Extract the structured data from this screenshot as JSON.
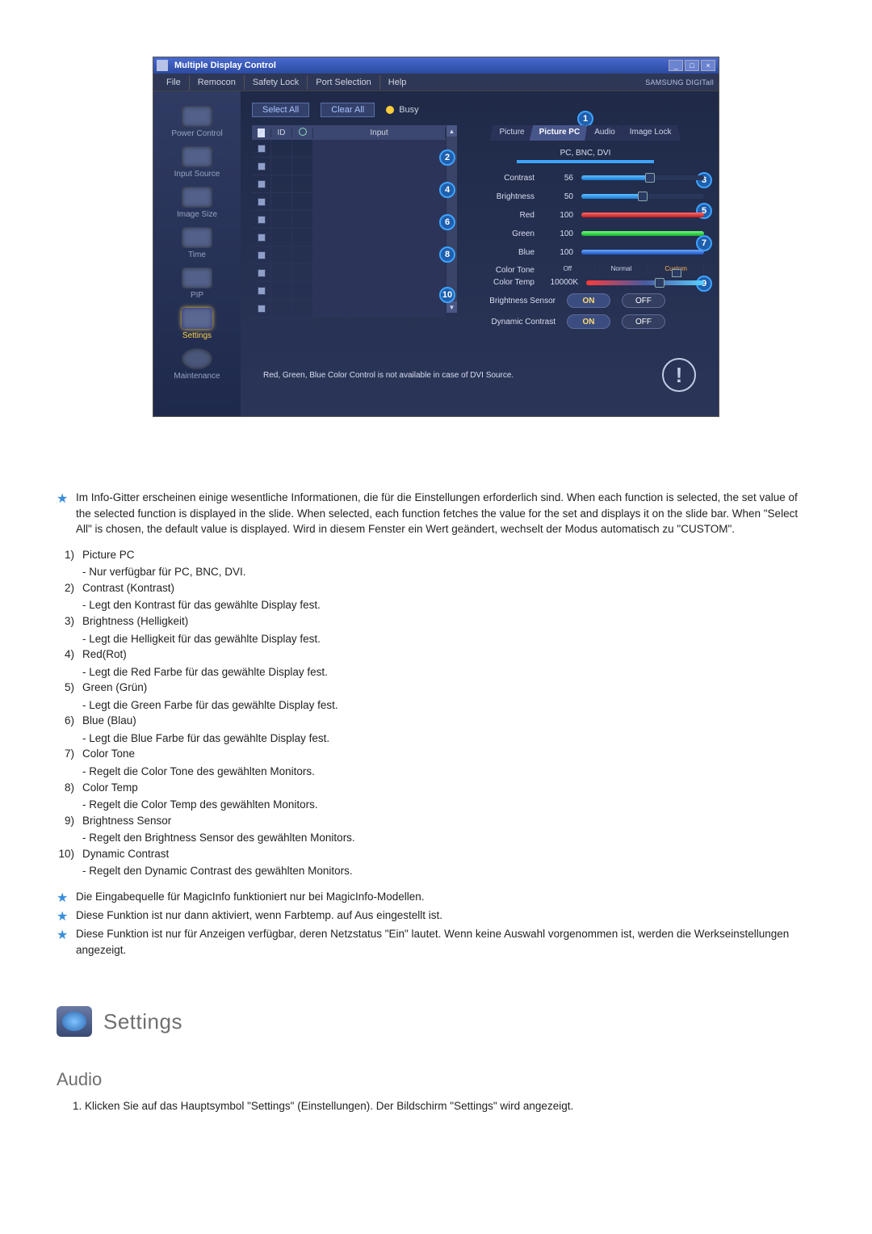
{
  "app": {
    "title": "Multiple Display Control",
    "brand": "SAMSUNG DIGITall",
    "menu": [
      "File",
      "Remocon",
      "Safety Lock",
      "Port Selection",
      "Help"
    ],
    "win_buttons": {
      "min": "_",
      "max": "□",
      "close": "×"
    },
    "sidebar": {
      "items": [
        {
          "label": "Power Control"
        },
        {
          "label": "Input Source"
        },
        {
          "label": "Image Size"
        },
        {
          "label": "Time"
        },
        {
          "label": "PIP"
        },
        {
          "label": "Settings"
        },
        {
          "label": "Maintenance"
        }
      ]
    },
    "top_actions": {
      "select_all": "Select All",
      "clear_all": "Clear All",
      "busy": "Busy"
    },
    "grid": {
      "cols": {
        "chk": "",
        "id": "ID",
        "pwr": "",
        "input": "Input"
      },
      "row_count": 10
    },
    "panel": {
      "tabs": [
        "Picture",
        "Picture PC",
        "Audio",
        "Image Lock"
      ],
      "active_tab": 1,
      "mode_label": "PC, BNC, DVI",
      "markers": {
        "1": "1",
        "2": "2",
        "3": "3",
        "4": "4",
        "5": "5",
        "6": "6",
        "7": "7",
        "8": "8",
        "9": "9",
        "10": "10"
      },
      "sliders": {
        "contrast": {
          "label": "Contrast",
          "value": "56",
          "pct": 56
        },
        "brightness": {
          "label": "Brightness",
          "value": "50",
          "pct": 50
        },
        "red": {
          "label": "Red",
          "value": "100",
          "pct": 100
        },
        "green": {
          "label": "Green",
          "value": "100",
          "pct": 100
        },
        "blue": {
          "label": "Blue",
          "value": "100",
          "pct": 100
        }
      },
      "color_tone": {
        "label": "Color Tone",
        "opts": [
          "Off",
          "Normal",
          "Custom"
        ],
        "sel_index": 2
      },
      "color_temp": {
        "label": "Color Temp",
        "value": "10000K",
        "pct": 62
      },
      "brightness_sensor": {
        "label": "Brightness Sensor",
        "on": "ON",
        "off": "OFF"
      },
      "dynamic_contrast": {
        "label": "Dynamic Contrast",
        "on": "ON",
        "off": "OFF"
      },
      "notice": "Red, Green, Blue Color Control is not available in case of DVI Source."
    }
  },
  "notes": {
    "intro": "Im Info-Gitter erscheinen einige wesentliche Informationen, die für die Einstellungen erforderlich sind. When each function is selected, the set value of the selected function is displayed in the slide. When selected, each function fetches the value for the set and displays it on the slide bar. When \"Select All\" is chosen, the default value is displayed. Wird in diesem Fenster ein Wert geändert, wechselt der Modus automatisch zu \"CUSTOM\".",
    "items": [
      {
        "n": "1)",
        "title": "Picture PC",
        "sub": "- Nur verfügbar für PC, BNC, DVI."
      },
      {
        "n": "2)",
        "title": "Contrast (Kontrast)",
        "sub": "- Legt den Kontrast für das gewählte Display fest."
      },
      {
        "n": "3)",
        "title": "Brightness (Helligkeit)",
        "sub": "- Legt die Helligkeit für das gewählte Display fest."
      },
      {
        "n": "4)",
        "title": "Red(Rot)",
        "sub": "- Legt die Red Farbe für das gewählte Display fest."
      },
      {
        "n": "5)",
        "title": "Green (Grün)",
        "sub": "- Legt die Green Farbe für das gewählte Display fest."
      },
      {
        "n": "6)",
        "title": "Blue (Blau)",
        "sub": "- Legt die Blue Farbe für das gewählte Display fest."
      },
      {
        "n": "7)",
        "title": "Color Tone",
        "sub": "- Regelt die Color Tone des gewählten Monitors."
      },
      {
        "n": "8)",
        "title": "Color Temp",
        "sub": "- Regelt die Color Temp des gewählten Monitors."
      },
      {
        "n": "9)",
        "title": "Brightness Sensor",
        "sub": "- Regelt den Brightness Sensor des gewählten Monitors."
      },
      {
        "n": "10)",
        "title": "Dynamic Contrast",
        "sub": "- Regelt den Dynamic Contrast des gewählten Monitors."
      }
    ],
    "footnotes": [
      "Die Eingabequelle für MagicInfo funktioniert nur bei MagicInfo-Modellen.",
      "Diese Funktion ist nur dann aktiviert, wenn Farbtemp. auf Aus eingestellt ist.",
      "Diese Funktion ist nur für Anzeigen verfügbar, deren Netzstatus \"Ein\" lautet. Wenn keine Auswahl vorgenommen ist, werden die Werkseinstellungen angezeigt."
    ]
  },
  "section": {
    "heading": "Settings",
    "sub_heading": "Audio",
    "step1": "1. Klicken Sie auf das Hauptsymbol \"Settings\" (Einstellungen). Der Bildschirm \"Settings\" wird angezeigt."
  }
}
